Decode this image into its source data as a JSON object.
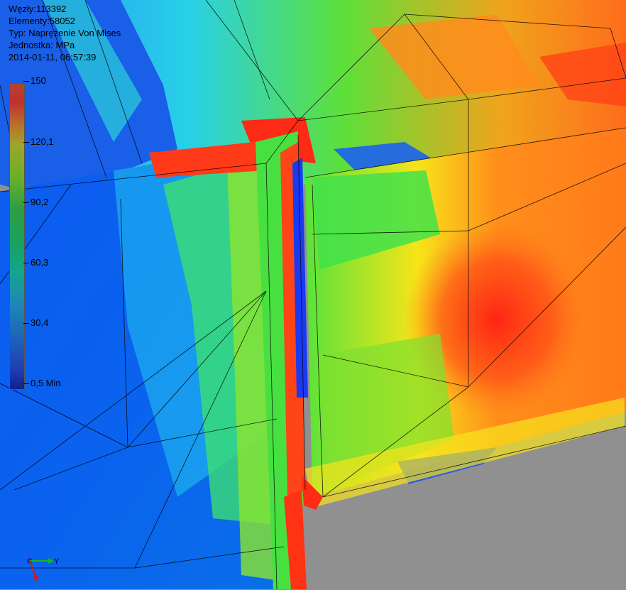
{
  "header": {
    "nodes": "Węzły:113392",
    "elements": "Elementy:58052",
    "type": "Typ: Naprężenie Von Mises",
    "unit": "Jednostka: MPa",
    "timestamp": "2014-01-11, 06:57:39"
  },
  "legend": {
    "ticks": [
      "150",
      "120,1",
      "90,2",
      "60,3",
      "30,4",
      "0,5 Min"
    ]
  },
  "triad": {
    "y_label": "Y",
    "z_label": "Z"
  },
  "colors": {
    "max": "#e8301c",
    "mid": "#2bd82b",
    "min": "#0b3df0",
    "background": "#909090"
  }
}
